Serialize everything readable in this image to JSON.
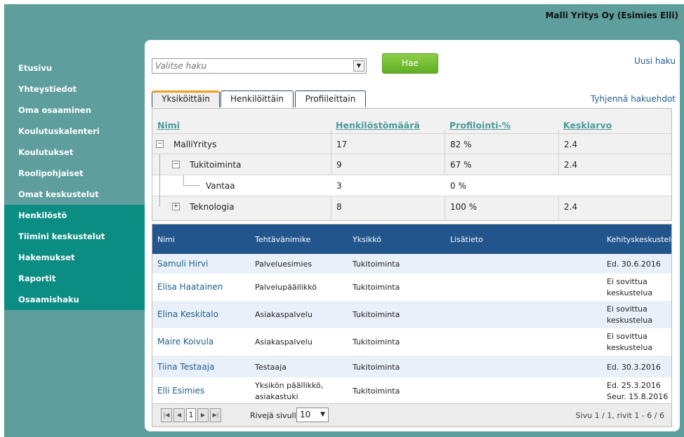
{
  "user": "Malli Yritys Oy (Esimies Elli)",
  "nav": [
    {
      "label": "Etusivu",
      "id": "etusivu"
    },
    {
      "label": "Yhteystiedot",
      "id": "yhteystiedot"
    },
    {
      "label": "Oma osaaminen",
      "id": "oma-osaaminen"
    },
    {
      "label": "Koulutuskalenteri",
      "id": "koulutuskalenteri"
    },
    {
      "label": "Koulutukset",
      "id": "koulutukset"
    },
    {
      "label": "Roolipohjaiset",
      "id": "roolipohjaiset"
    },
    {
      "label": "Omat keskustelut",
      "id": "omat-keskustelut"
    },
    {
      "label": "Henkilöstö",
      "id": "henkilosto"
    },
    {
      "label": "Tiimini keskustelut",
      "id": "tiimini-keskustelut"
    },
    {
      "label": "Hakemukset",
      "id": "hakemukset"
    },
    {
      "label": "Raportit",
      "id": "raportit"
    },
    {
      "label": "Osaamishaku",
      "id": "osaamishaku"
    }
  ],
  "search": {
    "placeholder": "Valitse haku",
    "button": "Hae",
    "new_search": "Uusi haku",
    "clear": "Tyhjennä hakuehdot"
  },
  "tabs": [
    "Yksiköittäin",
    "Henkilöittäin",
    "Profiileittain"
  ],
  "tree": {
    "headers": [
      "Nimi",
      "Henkilöstömäärä",
      "Profilointi-%",
      "Keskiarvo"
    ],
    "rows": [
      {
        "name": "MalliYritys",
        "count": "17",
        "pct": "82 %",
        "avg": "2.4"
      },
      {
        "name": "Tukitoiminta",
        "count": "9",
        "pct": "67 %",
        "avg": "2.4"
      },
      {
        "name": "Vantaa",
        "count": "3",
        "pct": "0 %",
        "avg": ""
      },
      {
        "name": "Teknologia",
        "count": "8",
        "pct": "100 %",
        "avg": "2.4"
      }
    ]
  },
  "grid": {
    "headers": [
      "Nimi",
      "Tehtävänimike",
      "Yksikkö",
      "Lisätieto",
      "Kehityskeskustelu"
    ],
    "rows": [
      {
        "name": "Samuli Hirvi",
        "title": "Palveluesimies",
        "unit": "Tukitoiminta",
        "info": "",
        "dev1": "Ed. 30.6.2016",
        "dev2": ""
      },
      {
        "name": "Elisa Haatainen",
        "title": "Palvelupäällikkö",
        "unit": "Tukitoiminta",
        "info": "",
        "dev1": "Ei sovittua",
        "dev2": "keskustelua"
      },
      {
        "name": "Elina Keskitalo",
        "title": "Asiakaspalvelu",
        "unit": "Tukitoiminta",
        "info": "",
        "dev1": "Ei sovittua",
        "dev2": "keskustelua"
      },
      {
        "name": "Maire Koivula",
        "title": "Asiakaspalvelu",
        "unit": "Tukitoiminta",
        "info": "",
        "dev1": "Ei sovittua",
        "dev2": "keskustelua"
      },
      {
        "name": "Tiina Testaaja",
        "title": "Testaaja",
        "unit": "Tukitoiminta",
        "info": "",
        "dev1": "Ed. 30.3.2016",
        "dev2": ""
      },
      {
        "name": "Elli Esimies",
        "title": "Yksikön päällikkö,",
        "title2": "asiakastuki",
        "unit": "Tukitoiminta",
        "info": "",
        "dev1": "Ed. 25.3.2016",
        "dev2": "Seur. 15.8.2016"
      }
    ]
  },
  "pager": {
    "page": "1",
    "rows_label": "Rivejä sivulla",
    "rows_value": "10",
    "summary": "Sivu 1 / 1, rivit 1 - 6 / 6"
  }
}
